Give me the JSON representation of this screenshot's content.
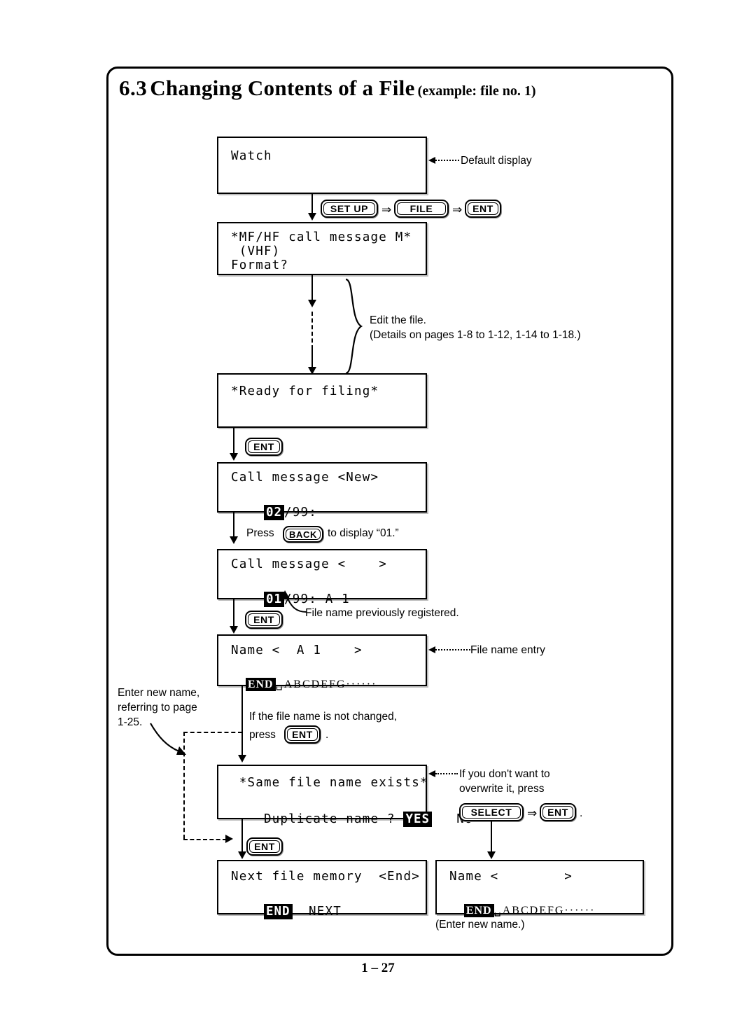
{
  "page": {
    "title_number": "6.3",
    "title_main": "Changing Contents of a File",
    "title_sub": "(example: file no. 1)",
    "footer": "1 – 27"
  },
  "displays": {
    "watch": {
      "line1": "Watch"
    },
    "mfhf": {
      "line1": "*MF/HF call message M*",
      "line2": " (VHF)",
      "line3": "Format?"
    },
    "ready": {
      "line1": "*Ready for filing*"
    },
    "call_new": {
      "line1": "Call message <New>",
      "badge": "02",
      "line2_rest": "/99:"
    },
    "call_01": {
      "line1": "Call message <    >",
      "badge": "01",
      "line2_rest": "/99: A 1"
    },
    "name_a1": {
      "line1": "Name <  A 1    >",
      "badge": "END",
      "line2_rest": "␣ABCDEFG······"
    },
    "same_name": {
      "line1": " *Same file name exists*",
      "line2_pre": "Duplicate name ? ",
      "badge": "YES",
      "line2_post": "   NO"
    },
    "next_file": {
      "line1": "Next file memory  <End>",
      "badge": "END",
      "line2_rest": "  NEXT"
    },
    "name_new": {
      "line1": "Name <        >",
      "badge": "END",
      "line2_rest": "␣ABCDEFG······"
    }
  },
  "keys": {
    "setup": "SET UP",
    "file": "FILE",
    "ent": "ENT",
    "ent2": "ENT",
    "ent3": "ENT",
    "ent4": "ENT",
    "ent5": "ENT",
    "ent6": "ENT",
    "back": "BACK",
    "select": "SELECT",
    "arrow_sep1": "⇒",
    "arrow_sep2": "⇒",
    "arrow_sep3": "⇒"
  },
  "annotations": {
    "default_display": "Default display",
    "edit_file_l1": "Edit the file.",
    "edit_file_l2": "(Details on pages 1-8 to 1-12, 1-14 to 1-18.)",
    "press_back_pre": "Press",
    "press_back_post": "to display “01.”",
    "prev_registered": "File name previously registered.",
    "file_name_entry": "File name entry",
    "enter_new_name_l1": "Enter new name,",
    "enter_new_name_l2": "referring to page",
    "enter_new_name_l3": "1-25.",
    "not_changed_l1": "If the file name is not changed,",
    "not_changed_l2_pre": "press",
    "not_changed_l2_post": ".",
    "no_overwrite_l1": "If you don't want to",
    "no_overwrite_l2": "overwrite it, press",
    "select_ent_period": ".",
    "enter_new_name_paren": "(Enter new name.)"
  }
}
